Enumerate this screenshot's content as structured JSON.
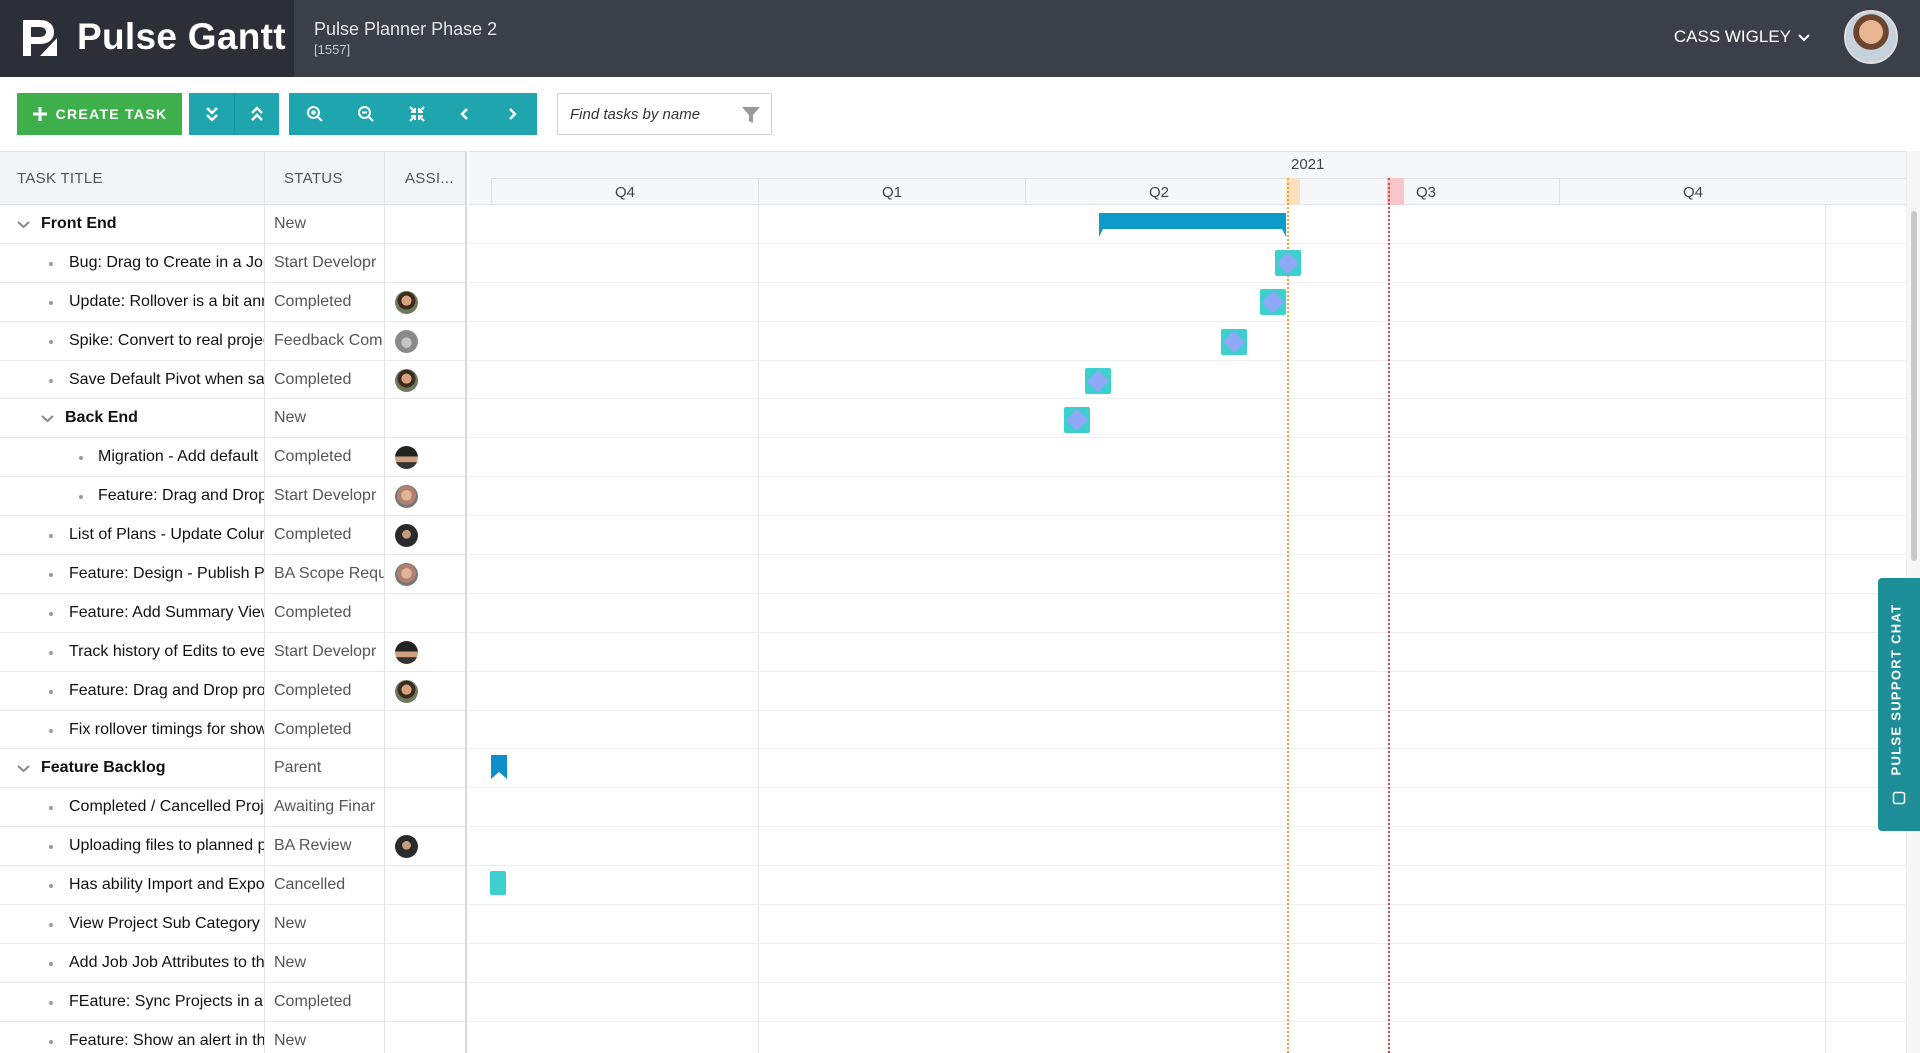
{
  "app": {
    "name": "Pulse Gantt",
    "project_title": "Pulse Planner Phase 2",
    "project_id": "[1557]"
  },
  "user": {
    "name": "CASS WIGLEY"
  },
  "toolbar": {
    "create_label": "CREATE TASK",
    "search_placeholder": "Find tasks by name"
  },
  "columns": {
    "title": "TASK TITLE",
    "status": "STATUS",
    "assignee": "ASSI..."
  },
  "timeline": {
    "year": "2021",
    "quarters": [
      "Q4",
      "Q1",
      "Q2",
      "Q3",
      "Q4"
    ]
  },
  "support": {
    "label": "PULSE SUPPORT CHAT"
  },
  "colors": {
    "accent": "#1ea5ad",
    "create": "#3eb04b",
    "topbar": "#3b3f4a",
    "milestone": "#3ecfcf",
    "summary": "#0f9bc7",
    "today": "#e8a33a",
    "deadline": "#e04040"
  },
  "rows": [
    {
      "title": "Front End",
      "status": "New",
      "level": 0,
      "parent": true,
      "assignee": null
    },
    {
      "title": "Bug: Drag to Create in a Job",
      "status": "Start Developr",
      "level": 1,
      "parent": false,
      "assignee": null
    },
    {
      "title": "Update: Rollover is a bit anno",
      "status": "Completed",
      "level": 1,
      "parent": false,
      "assignee": "av-a"
    },
    {
      "title": "Spike: Convert to real projec",
      "status": "Feedback Com",
      "level": 1,
      "parent": false,
      "assignee": "av-b"
    },
    {
      "title": "Save Default Pivot when sav",
      "status": "Completed",
      "level": 1,
      "parent": false,
      "assignee": "av-a"
    },
    {
      "title": "Back End",
      "status": "New",
      "level": 1,
      "parent": true,
      "assignee": null
    },
    {
      "title": "Migration - Add default",
      "status": "Completed",
      "level": 2,
      "parent": false,
      "assignee": "av-c"
    },
    {
      "title": "Feature: Drag and Drop",
      "status": "Start Developr",
      "level": 2,
      "parent": false,
      "assignee": "av-d"
    },
    {
      "title": "List of Plans - Update Colum",
      "status": "Completed",
      "level": 1,
      "parent": false,
      "assignee": "av-e"
    },
    {
      "title": "Feature: Design - Publish Pla",
      "status": "BA Scope Requ",
      "level": 1,
      "parent": false,
      "assignee": "av-d"
    },
    {
      "title": "Feature: Add Summary View",
      "status": "Completed",
      "level": 1,
      "parent": false,
      "assignee": null
    },
    {
      "title": "Track history of Edits to ever",
      "status": "Start Developr",
      "level": 1,
      "parent": false,
      "assignee": "av-c"
    },
    {
      "title": "Feature: Drag and Drop proj",
      "status": "Completed",
      "level": 1,
      "parent": false,
      "assignee": "av-a"
    },
    {
      "title": "Fix rollover timings for show",
      "status": "Completed",
      "level": 1,
      "parent": false,
      "assignee": null
    },
    {
      "title": "Feature Backlog",
      "status": "Parent",
      "level": 0,
      "parent": true,
      "assignee": null
    },
    {
      "title": "Completed / Cancelled Proje",
      "status": "Awaiting Finar",
      "level": 1,
      "parent": false,
      "assignee": null
    },
    {
      "title": "Uploading files to planned pr",
      "status": "BA Review",
      "level": 1,
      "parent": false,
      "assignee": "av-e"
    },
    {
      "title": "Has ability Import and Expor",
      "status": "Cancelled",
      "level": 1,
      "parent": false,
      "assignee": null
    },
    {
      "title": "View Project Sub Category ir",
      "status": "New",
      "level": 1,
      "parent": false,
      "assignee": null
    },
    {
      "title": "Add Job Job Attributes to the",
      "status": "New",
      "level": 1,
      "parent": false,
      "assignee": null
    },
    {
      "title": "FEature: Sync Projects in a V",
      "status": "Completed",
      "level": 1,
      "parent": false,
      "assignee": null
    },
    {
      "title": "Feature: Show an alert in the",
      "status": "New",
      "level": 1,
      "parent": false,
      "assignee": null
    }
  ]
}
